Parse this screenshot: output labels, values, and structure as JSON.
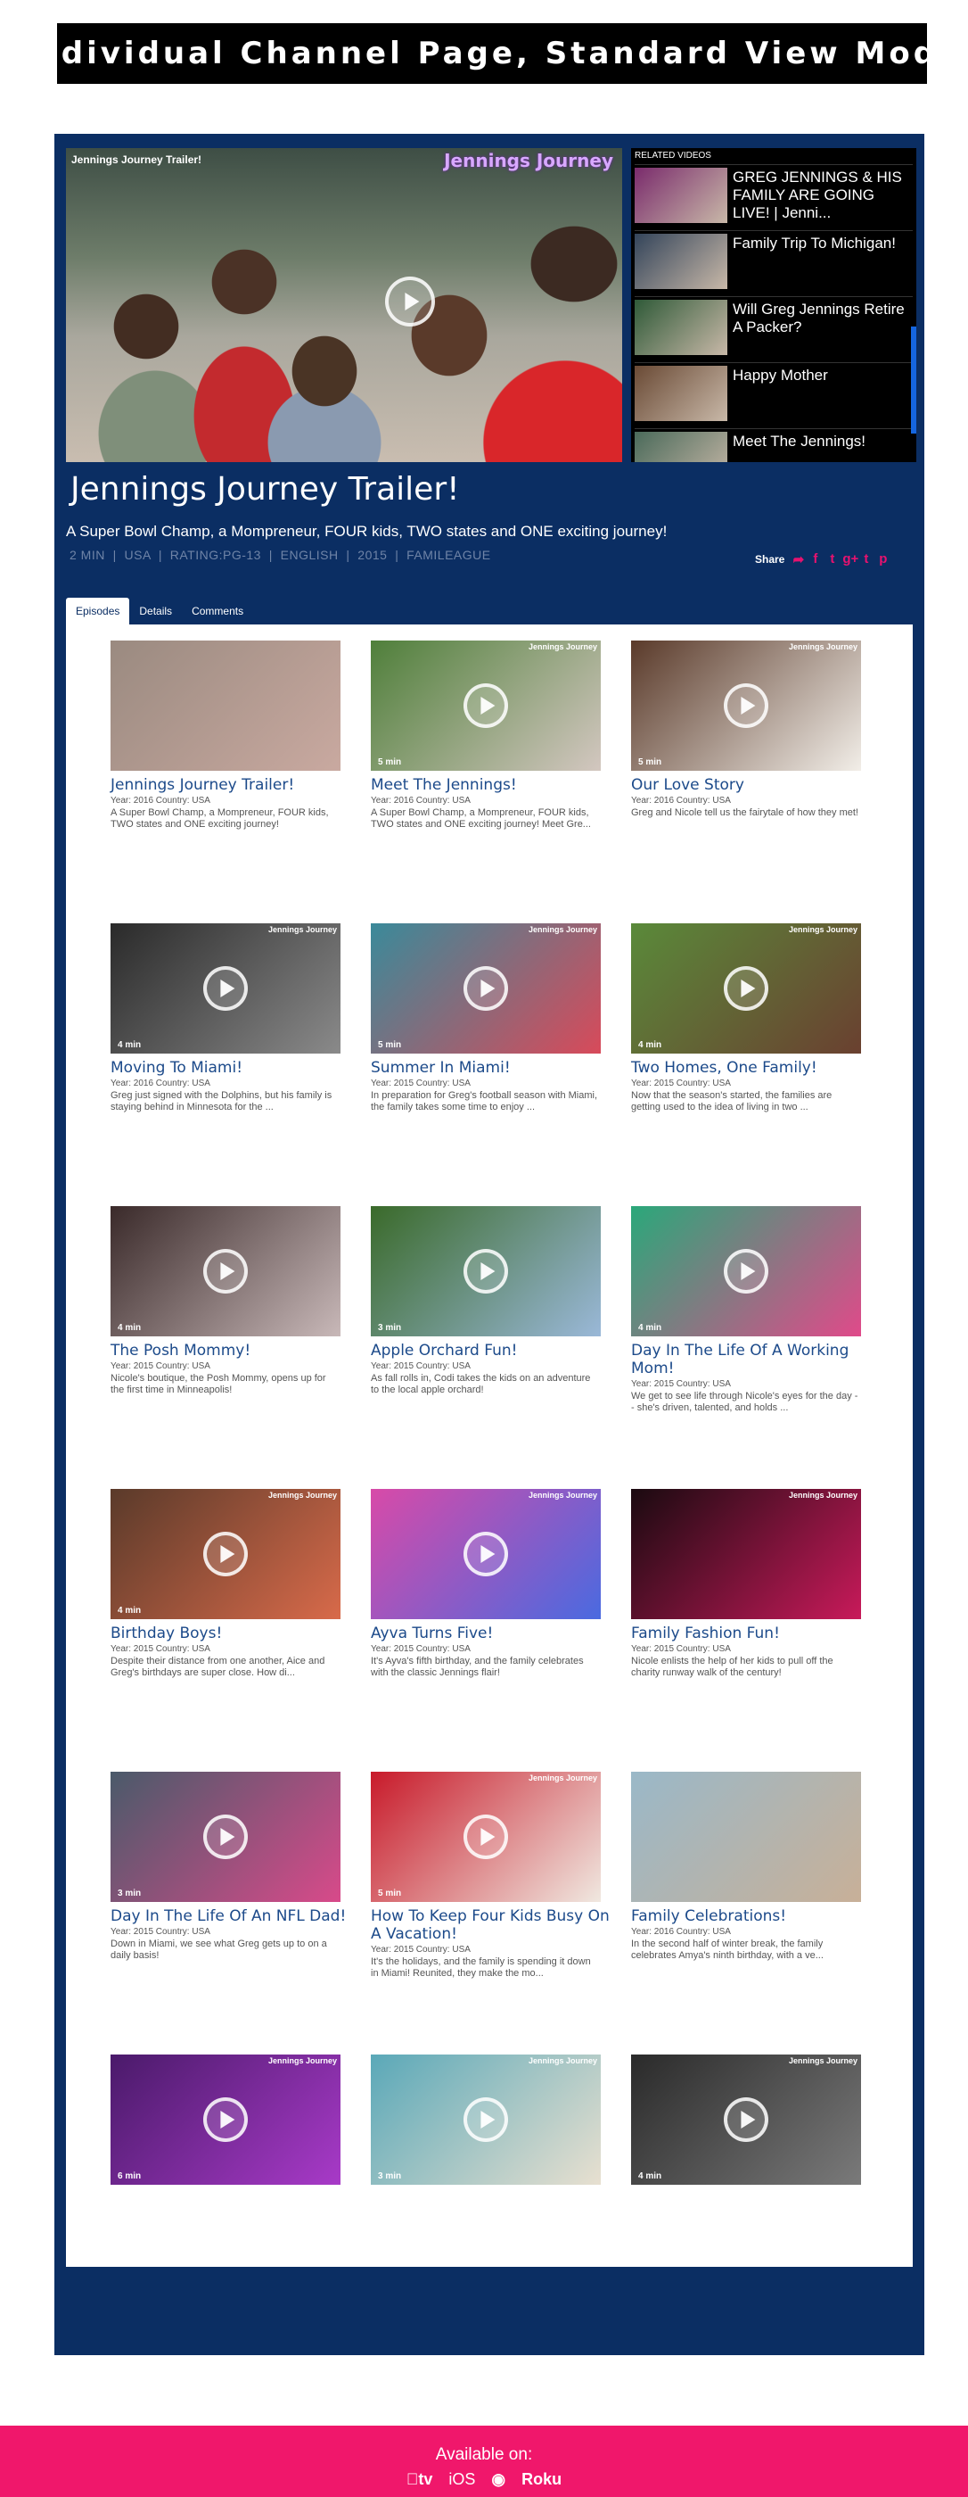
{
  "banner": "Individual Channel Page, Standard View Mode",
  "player": {
    "overlay_title": "Jennings Journey Trailer!",
    "logo": "Jennings Journey"
  },
  "related": {
    "heading": "RELATED VIDEOS",
    "items": [
      {
        "title": "GREG JENNINGS & HIS FAMILY ARE GOING LIVE! | Jenni...",
        "color": "#7a2b6c"
      },
      {
        "title": "Family Trip To Michigan!",
        "color": "#33445a"
      },
      {
        "title": "Will Greg Jennings Retire A Packer?",
        "color": "#2f5a38"
      },
      {
        "title": "Happy Mother",
        "color": "#6a4a35"
      },
      {
        "title": "Meet The Jennings!",
        "color": "#4a6a5a"
      }
    ]
  },
  "title": "Jennings Journey Trailer!",
  "description": "A Super Bowl Champ, a Mompreneur, FOUR kids, TWO states and ONE exciting journey!",
  "meta": "2 MIN  |  USA  |  RATING:PG-13  |  ENGLISH  |  2015  |  FAMILEAGUE",
  "share": {
    "label": "Share",
    "icons": [
      "share-arrow-icon",
      "facebook-icon",
      "twitter-icon",
      "google-plus-icon",
      "tumblr-icon",
      "pinterest-icon"
    ],
    "glyphs": [
      "➦",
      "f",
      "t",
      "g+",
      "t",
      "p"
    ]
  },
  "tabs": [
    "Episodes",
    "Details",
    "Comments"
  ],
  "episodes": [
    {
      "title": "Jennings Journey Trailer!",
      "meta": "Year: 2016 Country: USA",
      "desc": "A Super Bowl Champ, a Mompreneur, FOUR kids, TWO states and ONE exciting journey!",
      "duration": "",
      "brand": "",
      "play": false,
      "colors": [
        "#9a8a80",
        "#c9a9a0"
      ]
    },
    {
      "title": "Meet The Jennings!",
      "meta": "Year: 2016 Country: USA",
      "desc": "A Super Bowl Champ, a Mompreneur, FOUR kids, TWO states and ONE exciting journey! Meet Gre...",
      "duration": "5 min",
      "brand": "Jennings Journey",
      "play": true,
      "colors": [
        "#4f7f3a",
        "#d3c7c0"
      ]
    },
    {
      "title": "Our Love Story",
      "meta": "Year: 2016 Country: USA",
      "desc": "Greg and Nicole tell us the fairytale of how they met!",
      "duration": "5 min",
      "brand": "Jennings Journey",
      "play": true,
      "colors": [
        "#5a3a2a",
        "#f2eee8"
      ]
    },
    {
      "title": "Moving To Miami!",
      "meta": "Year: 2016 Country: USA",
      "desc": "Greg just signed with the Dolphins, but his family is staying behind in Minnesota for the ...",
      "duration": "4 min",
      "brand": "Jennings Journey",
      "play": true,
      "colors": [
        "#2a2a2a",
        "#8a8a8a"
      ]
    },
    {
      "title": "Summer In Miami!",
      "meta": "Year: 2015 Country: USA",
      "desc": "In preparation for Greg's football season with Miami, the family takes some time to enjoy ...",
      "duration": "5 min",
      "brand": "Jennings Journey",
      "play": true,
      "colors": [
        "#3a8a9a",
        "#d84a5a"
      ]
    },
    {
      "title": "Two Homes, One Family!",
      "meta": "Year: 2015 Country: USA",
      "desc": "Now that the season's started, the families are getting used to the idea of living in two ...",
      "duration": "4 min",
      "brand": "Jennings Journey",
      "play": true,
      "colors": [
        "#5a8a3a",
        "#6a4030"
      ]
    },
    {
      "title": "The Posh Mommy!",
      "meta": "Year: 2015 Country: USA",
      "desc": "Nicole's boutique, the Posh Mommy, opens up for the first time in Minneapolis!",
      "duration": "4 min",
      "brand": "",
      "play": true,
      "colors": [
        "#3a2a2a",
        "#c8b8b8"
      ]
    },
    {
      "title": "Apple Orchard Fun!",
      "meta": "Year: 2015 Country: USA",
      "desc": "As fall rolls in, Codi takes the kids on an adventure to the local apple orchard!",
      "duration": "3 min",
      "brand": "",
      "play": true,
      "colors": [
        "#3a6a2a",
        "#9ab8d8"
      ]
    },
    {
      "title": "Day In The Life Of A Working Mom!",
      "meta": "Year: 2015 Country: USA",
      "desc": "We get to see life through Nicole's eyes for the day -- she's driven, talented, and holds ...",
      "duration": "4 min",
      "brand": "",
      "play": true,
      "colors": [
        "#2aa87a",
        "#e04a8a"
      ]
    },
    {
      "title": "Birthday Boys!",
      "meta": "Year: 2015 Country: USA",
      "desc": "Despite their distance from one another, Aice and Greg's birthdays are super close. How di...",
      "duration": "4 min",
      "brand": "Jennings Journey",
      "play": true,
      "colors": [
        "#5a3a2a",
        "#d86a4a"
      ]
    },
    {
      "title": "Ayva Turns Five!",
      "meta": "Year: 2015 Country: USA",
      "desc": "It's Ayva's fifth birthday, and the family celebrates with the classic Jennings flair!",
      "duration": "",
      "brand": "Jennings Journey",
      "play": true,
      "colors": [
        "#d84aa8",
        "#4a6ae0"
      ]
    },
    {
      "title": "Family Fashion Fun!",
      "meta": "Year: 2015 Country: USA",
      "desc": "Nicole enlists the help of her kids to pull off the charity runway walk of the century!",
      "duration": "",
      "brand": "Jennings Journey",
      "play": false,
      "colors": [
        "#1a0a10",
        "#c81a5a"
      ]
    },
    {
      "title": "Day In The Life Of An NFL Dad!",
      "meta": "Year: 2015 Country: USA",
      "desc": "Down in Miami, we see what Greg gets up to on a daily basis!",
      "duration": "3 min",
      "brand": "",
      "play": true,
      "colors": [
        "#4a5a6a",
        "#d84a8a"
      ]
    },
    {
      "title": "How To Keep Four Kids Busy On A Vacation!",
      "meta": "Year: 2015 Country: USA",
      "desc": "It's the holidays, and the family is spending it down in Miami! Reunited, they make the mo...",
      "duration": "5 min",
      "brand": "Jennings Journey",
      "play": true,
      "colors": [
        "#c81a2a",
        "#f0e8e0"
      ]
    },
    {
      "title": "Family Celebrations!",
      "meta": "Year: 2016 Country: USA",
      "desc": "In the second half of winter break, the family celebrates Amya's ninth birthday, with a ve...",
      "duration": "",
      "brand": "",
      "play": false,
      "colors": [
        "#9ab8c8",
        "#c8b098"
      ]
    },
    {
      "title": "",
      "meta": "",
      "desc": "",
      "duration": "6 min",
      "brand": "Jennings Journey",
      "play": true,
      "colors": [
        "#4a1a6a",
        "#a83ac8"
      ]
    },
    {
      "title": "",
      "meta": "",
      "desc": "",
      "duration": "3 min",
      "brand": "Jennings Journey",
      "play": true,
      "colors": [
        "#5aa8b8",
        "#e8e0d0"
      ]
    },
    {
      "title": "",
      "meta": "",
      "desc": "",
      "duration": "4 min",
      "brand": "Jennings Journey",
      "play": true,
      "colors": [
        "#2a2a2a",
        "#7a7a7a"
      ]
    }
  ],
  "footer": {
    "available": "Available on:",
    "platforms": [
      "tv",
      "iOS",
      "android-icon",
      "Roku"
    ]
  }
}
